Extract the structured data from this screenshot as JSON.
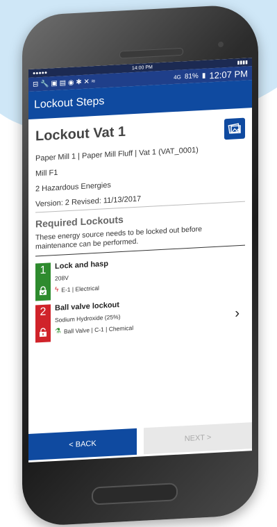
{
  "status_top": {
    "dots": "●●●●●",
    "time": "14:00 PM",
    "battery": "▮▮▮▮"
  },
  "status": {
    "icons": "⊟ 🔧 ▣ ▤ ◉ ✱ ✕ ≈",
    "network": "4G",
    "battery": "81%",
    "clock": "12:07 PM"
  },
  "appbar": {
    "title": "Lockout Steps"
  },
  "header": {
    "title": "Lockout Vat 1",
    "path": "Paper Mill 1 | Paper Mill Fluff | Vat 1 (VAT_0001)",
    "location": "Mill F1",
    "energies": "2 Hazardous Energies",
    "version": "Version: 2 Revised: 11/13/2017"
  },
  "required": {
    "title": "Required Lockouts",
    "description": "These energy source needs to be locked out before maintenance can be performed."
  },
  "lockouts": [
    {
      "num": "1",
      "title": "Lock and hasp",
      "sub": "208V",
      "energy": "E-1 | Electrical",
      "status": "locked",
      "color": "#2e8b2e"
    },
    {
      "num": "2",
      "title": "Ball valve lockout",
      "sub": "Sodium Hydroxide (25%)",
      "energy": "Ball Valve | C-1 | Chemical",
      "status": "unlocked",
      "color": "#d0232a"
    }
  ],
  "buttons": {
    "back": "< BACK",
    "next": "NEXT >"
  }
}
